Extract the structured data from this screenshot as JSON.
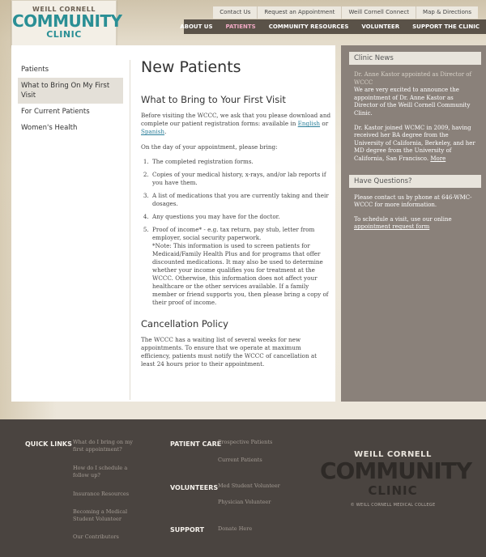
{
  "logo": {
    "line1": "WEILL CORNELL",
    "line2": "COMMUNITY",
    "line3": "CLINIC"
  },
  "util_nav": [
    "Contact Us",
    "Request an Appointment",
    "Weill Cornell Connect",
    "Map & Directions"
  ],
  "main_nav": [
    {
      "label": "ABOUT US",
      "active": false
    },
    {
      "label": "PATIENTS",
      "active": true
    },
    {
      "label": "COMMUNITY RESOURCES",
      "active": false
    },
    {
      "label": "VOLUNTEER",
      "active": false
    },
    {
      "label": "SUPPORT THE CLINIC",
      "active": false
    }
  ],
  "left_nav": [
    {
      "label": "Patients",
      "active": false
    },
    {
      "label": "What to Bring On My First Visit",
      "active": true
    },
    {
      "label": "For Current Patients",
      "active": false
    },
    {
      "label": "Women's Health",
      "active": false
    }
  ],
  "main": {
    "title": "New Patients",
    "section1_title": "What to Bring to Your First Visit",
    "intro_before": "Before visiting the WCCC, we ask that you please download and complete our patient registration forms: available in ",
    "intro_link_english": "English",
    "intro_or": " or ",
    "intro_link_spanish": "Spanish",
    "intro_end": ".",
    "day_of": "On the day of your appointment, please bring:",
    "list": [
      "The completed registration forms.",
      "Copies of your medical history, x-rays, and/or lab reports if you have them.",
      "A list of medications that you are currently taking and their dosages.",
      "Any questions you may have for the doctor.",
      "Proof of income* - e.g. tax return, pay stub, letter from employer, social security paperwork."
    ],
    "note": "*Note: This information is used to screen patients for Medicaid/Family Health Plus and for programs that offer discounted medications. It may also be used to determine whether your income qualifies you for treatment at the WCCC. Otherwise, this information does not affect your healthcare or the other services available. If a family member or friend supports you, then please bring a copy of their proof of income.",
    "section2_title": "Cancellation Policy",
    "cancel_text": "The WCCC has a waiting list of several weeks for new appointments. To ensure that we operate at maximum efficiency, patients must notify the WCCC of cancellation at least 24 hours prior to their appointment."
  },
  "sidebar": {
    "news_title": "Clinic News",
    "news_headline": "Dr. Anne Kastor appointed as Director of WCCC",
    "news_p1": "We are very excited to announce the appointment of Dr. Anne Kastor as Director of the Weill Cornell Community Clinic.",
    "news_p2": "Dr. Kastor joined WCMC in 2009, having received her BA degree from the University of California, Berkeley, and her MD degree from the University of California, San Francisco.",
    "news_more": "More",
    "questions_title": "Have Questions?",
    "q_p1": "Please contact us by phone at 646-WMC-WCCC for more information.",
    "q_p2": "To schedule a visit, use our online",
    "q_link": "appointment request form"
  },
  "footer": {
    "quick_links_head": "QUICK LINKS",
    "quick_links": [
      "What do I bring on my first appointment?",
      "How do I schedule a follow up?",
      "Insurance Resources",
      "Becoming a Medical Student Volunteer",
      "Our Contributors"
    ],
    "patient_care_head": "PATIENT CARE",
    "patient_care": [
      "Prospective Patients",
      "Current Patients"
    ],
    "volunteers_head": "VOLUNTEERS",
    "volunteers": [
      "Med Student Volunteer",
      "Physician Volunteer"
    ],
    "support_head": "SUPPORT",
    "support": [
      "Donate Here"
    ],
    "logo_line1": "WEILL CORNELL",
    "logo_line2": "COMMUNITY",
    "logo_line3": "CLINIC",
    "logo_sub": "© WEILL CORNELL MEDICAL COLLEGE"
  }
}
